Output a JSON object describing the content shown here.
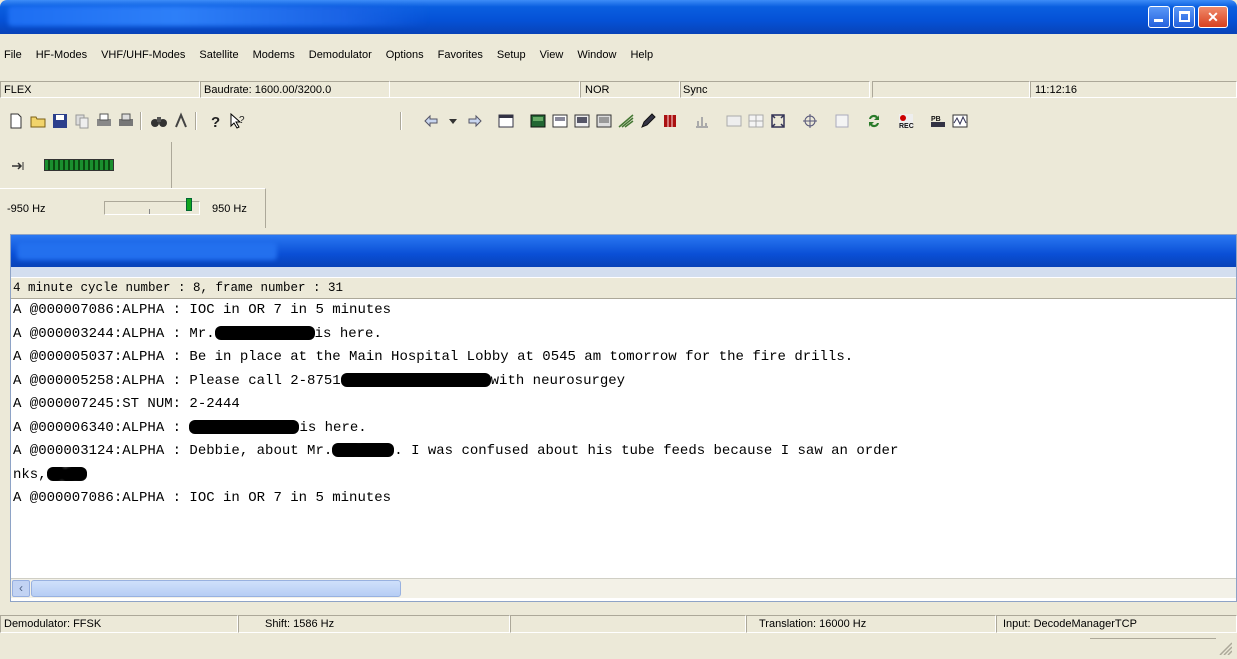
{
  "menu": [
    "File",
    "HF-Modes",
    "VHF/UHF-Modes",
    "Satellite",
    "Modems",
    "Demodulator",
    "Options",
    "Favorites",
    "Setup",
    "View",
    "Window",
    "Help"
  ],
  "status_top": {
    "mode": "FLEX",
    "baudrate": "Baudrate: 1600.00/3200.0",
    "polarity": "NOR",
    "sync": "Sync",
    "time": "11:12:16"
  },
  "tuning": {
    "left_freq": "-950 Hz",
    "right_freq": "950 Hz"
  },
  "output": {
    "header": "4 minute cycle number :  8, frame number :  31",
    "lines": [
      {
        "pre": "A @000007086:ALPHA : IOC in OR 7 in 5 minutes",
        "post": ""
      },
      {
        "pre": "A @000003244:ALPHA : Mr.",
        "post": "is here."
      },
      {
        "pre": "A @000005037:ALPHA : Be in place at the Main Hospital Lobby at 0545 am tomorrow for the fire drills.",
        "post": ""
      },
      {
        "pre": "A @000005258:ALPHA : Please call 2-8751",
        "post": "with neurosurgey"
      },
      {
        "pre": "A @000007245:ST NUM: 2-2444",
        "post": ""
      },
      {
        "pre": "A @000006340:ALPHA : ",
        "post": "is here."
      },
      {
        "pre": "A @000003124:ALPHA : Debbie, about Mr.",
        "post": ". I was confused about his tube feeds because I saw an order"
      },
      {
        "pre": "nks,",
        "post": ""
      },
      {
        "pre": "A @000007086:ALPHA : IOC in OR 7 in 5 minutes",
        "post": ""
      }
    ]
  },
  "status_bottom": {
    "demodulator": "Demodulator: FFSK",
    "shift": "Shift: 1586 Hz",
    "translation": "Translation: 16000 Hz",
    "input": "Input: DecodeManagerTCP"
  }
}
